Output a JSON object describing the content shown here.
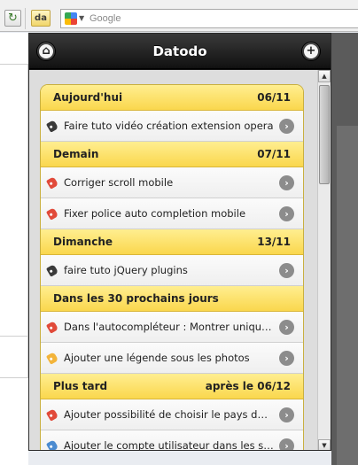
{
  "browser": {
    "search_placeholder": "Google",
    "ext_button_label": "da",
    "reload_icon": "reload-icon"
  },
  "popup": {
    "title": "Datodo",
    "home_icon": "home-icon",
    "add_icon": "plus-icon",
    "groups": [
      {
        "label": "Aujourd'hui",
        "date": "06/11",
        "items": [
          {
            "label": "Faire tuto vidéo création extension opera",
            "color": "dark"
          }
        ]
      },
      {
        "label": "Demain",
        "date": "07/11",
        "items": [
          {
            "label": "Corriger scroll mobile",
            "color": "red"
          },
          {
            "label": "Fixer police auto completion mobile",
            "color": "red"
          }
        ]
      },
      {
        "label": "Dimanche",
        "date": "13/11",
        "items": [
          {
            "label": "faire tuto jQuery plugins",
            "color": "dark"
          }
        ]
      },
      {
        "label": "Dans les 30 prochains jours",
        "date": "",
        "items": [
          {
            "label": "Dans l'autocompléteur : Montrer uniqueme...",
            "color": "red"
          },
          {
            "label": "Ajouter une légende sous les photos",
            "color": "orange"
          }
        ]
      },
      {
        "label": "Plus tard",
        "date": "après le 06/12",
        "items": [
          {
            "label": "Ajouter possibilité de choisir le pays du pr...",
            "color": "red"
          },
          {
            "label": "Ajouter le compte utilisateur dans les stats",
            "color": "blue"
          }
        ]
      }
    ]
  },
  "colors": {
    "divider_top": "#ffee90",
    "divider_bottom": "#fad74d",
    "header_bg": "#111111"
  }
}
